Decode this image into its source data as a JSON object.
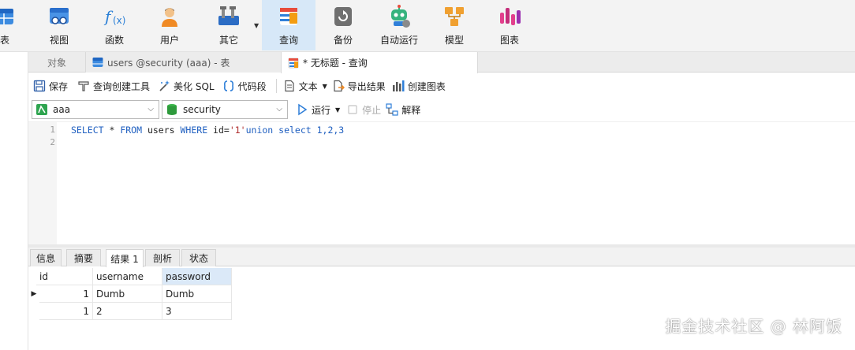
{
  "ribbon": {
    "items": [
      {
        "label": "表",
        "icon": "table-icon"
      },
      {
        "label": "视图",
        "icon": "view-icon"
      },
      {
        "label": "函数",
        "icon": "function-icon"
      },
      {
        "label": "用户",
        "icon": "user-icon"
      },
      {
        "label": "其它",
        "icon": "tools-icon"
      },
      {
        "label": "查询",
        "icon": "query-icon",
        "active": true
      },
      {
        "label": "备份",
        "icon": "backup-icon"
      },
      {
        "label": "自动运行",
        "icon": "robot-icon"
      },
      {
        "label": "模型",
        "icon": "model-icon"
      },
      {
        "label": "图表",
        "icon": "chart-icon"
      }
    ]
  },
  "tabs": {
    "objects": "对象",
    "table_tab": "users @security (aaa) - 表",
    "query_tab": "* 无标题 - 查询"
  },
  "query_toolbar": {
    "save": "保存",
    "query_builder": "查询创建工具",
    "beautify": "美化 SQL",
    "snippet": "代码段",
    "text": "文本",
    "export": "导出结果",
    "create_chart": "创建图表"
  },
  "connection": {
    "connection_name": "aaa",
    "database": "security",
    "run": "运行",
    "stop": "停止",
    "explain": "解释"
  },
  "editor": {
    "line_numbers": [
      "1",
      "2"
    ],
    "sql": {
      "kw1": "SELECT",
      "star": " * ",
      "kw2": "FROM",
      "t1": " users ",
      "kw3": "WHERE",
      "t2": " id=",
      "s1": "'1'",
      "t3": "union select 1,2,3"
    }
  },
  "result_tabs": [
    "信息",
    "摘要",
    "结果 1",
    "剖析",
    "状态"
  ],
  "result_grid": {
    "columns": [
      "id",
      "username",
      "password"
    ],
    "rows": [
      [
        "1",
        "Dumb",
        "Dumb"
      ],
      [
        "1",
        "2",
        "3"
      ]
    ]
  },
  "watermark": "掘金技术社区 @ 林阿饭",
  "colors": {
    "accent": "#2f7fd8",
    "active_ribbon": "#d7e8f8",
    "keyword": "#1f5fc0",
    "string": "#b03030"
  }
}
